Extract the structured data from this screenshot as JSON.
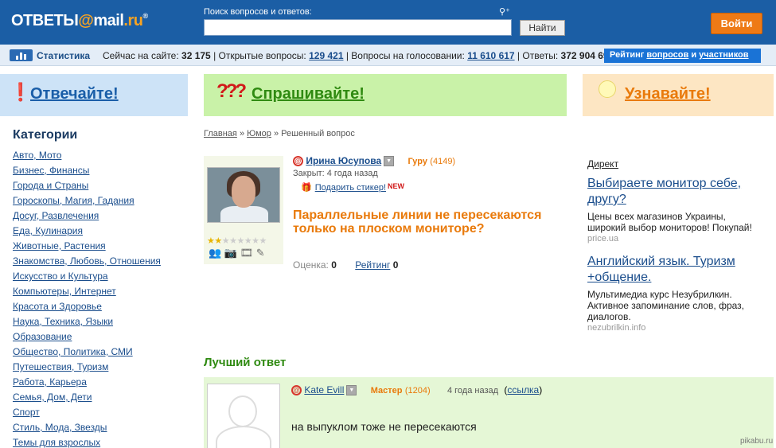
{
  "header": {
    "logo_prefix": "ОТВЕТЫ",
    "logo_at": "@",
    "logo_brand": "mail",
    "logo_domain": ".ru",
    "logo_reg": "®",
    "search_label": "Поиск вопросов и ответов:",
    "search_value": "",
    "search_button": "Найти",
    "login_button": "Войти"
  },
  "stats": {
    "title": "Статистика",
    "online_label": "Сейчас на сайте:",
    "online_value": "32 175",
    "open_label": "Открытые вопросы:",
    "open_value": "129 421",
    "voting_label": "Вопросы на голосовании:",
    "voting_value": "11 610 617",
    "answers_label": "Ответы:",
    "answers_value": "372 904 693",
    "rating_prefix": "Рейтинг",
    "rating_questions": "вопросов",
    "rating_and": "и",
    "rating_users": "участников"
  },
  "banners": {
    "answer": "Отвечайте!",
    "ask_icon": "???",
    "ask": "Спрашивайте!",
    "learn": "Узнавайте!"
  },
  "categories": {
    "title": "Категории",
    "items": [
      "Авто, Мото",
      "Бизнес, Финансы",
      "Города и Страны",
      "Гороскопы, Магия, Гадания",
      "Досуг, Развлечения",
      "Еда, Кулинария",
      "Животные, Растения",
      "Знакомства, Любовь, Отношения",
      "Искусство и Культура",
      "Компьютеры, Интернет",
      "Красота и Здоровье",
      "Наука, Техника, Языки",
      "Образование",
      "Общество, Политика, СМИ",
      "Путешествия, Туризм",
      "Работа, Карьера",
      "Семья, Дом, Дети",
      "Спорт",
      "Стиль, Мода, Звезды",
      "Темы для взрослых"
    ]
  },
  "breadcrumb": {
    "home": "Главная",
    "sep": "»",
    "section": "Юмор",
    "current": "Решенный вопрос"
  },
  "question": {
    "author": "Ирина Юсупова",
    "rank": "Гуру",
    "points": "(4149)",
    "closed": "Закрыт: 4 года назад",
    "gift": "Подарить стикер!",
    "gift_badge": "NEW",
    "text": "Параллельные линии не пересекаются только на плоском мониторе?",
    "score_label": "Оценка:",
    "score_value": "0",
    "rating_label": "Рейтинг",
    "rating_value": "0",
    "stars_filled": 2,
    "stars_total": 8
  },
  "ads": {
    "label": "Директ",
    "items": [
      {
        "title": "Выбираете монитор себе, другу?",
        "text": "Цены всех магазинов Украины, широкий выбор мониторов! Покупай!",
        "url": "price.ua"
      },
      {
        "title": "Английский язык. Туризм +общение.",
        "text": "Мультимедиа курс Незубрилкин. Активное запоминание слов, фраз, диалогов.",
        "url": "nezubrilkin.info"
      }
    ]
  },
  "best_answer": {
    "title": "Лучший ответ",
    "author": "Kate Evill",
    "rank": "Мастер",
    "points": "(1204)",
    "ago": "4 года назад",
    "link_open": "(",
    "link": "ссылка",
    "link_close": ")",
    "text": "на выпуклом тоже не пересекаются"
  },
  "watermark": "pikabu.ru",
  "colors": {
    "header_bg": "#1b5ea5",
    "accent_orange": "#e97a0b",
    "green": "#2f8a11",
    "link": "#1a4d8c"
  }
}
